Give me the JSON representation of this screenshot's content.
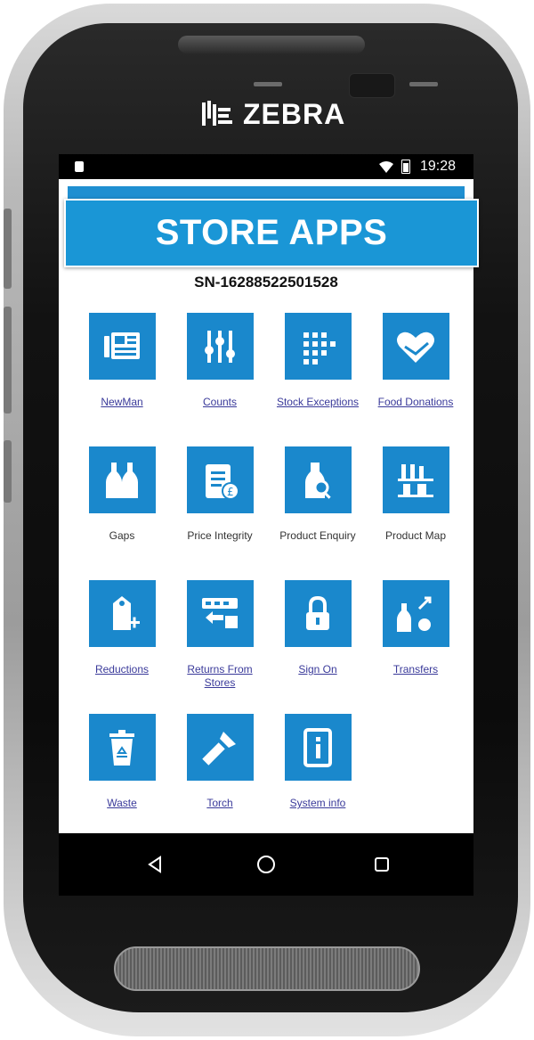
{
  "device": {
    "brand": "ZEBRA"
  },
  "status_bar": {
    "time": "19:28"
  },
  "banner": {
    "title": "STORE APPS"
  },
  "serial": "SN-16288522501528",
  "apps": [
    {
      "label": "NewMan",
      "icon": "newspaper-icon"
    },
    {
      "label": "Counts",
      "icon": "counts-icon"
    },
    {
      "label": "Stock Exceptions",
      "icon": "stock-exceptions-icon"
    },
    {
      "label": "Food Donations",
      "icon": "heart-hands-icon"
    },
    {
      "label": "Gaps",
      "icon": "bottles-icon"
    },
    {
      "label": "Price Integrity",
      "icon": "price-clipboard-icon"
    },
    {
      "label": "Product Enquiry",
      "icon": "bottle-search-icon"
    },
    {
      "label": "Product Map",
      "icon": "shelf-icon"
    },
    {
      "label": "Reductions",
      "icon": "price-tag-icon"
    },
    {
      "label": "Returns From Stores",
      "icon": "store-return-icon"
    },
    {
      "label": "Sign On",
      "icon": "lock-icon"
    },
    {
      "label": "Transfers",
      "icon": "transfer-icon"
    },
    {
      "label": "Waste",
      "icon": "recycle-bin-icon"
    },
    {
      "label": "Torch",
      "icon": "flashlight-icon"
    },
    {
      "label": "System info",
      "icon": "info-icon"
    }
  ],
  "colors": {
    "tile": "#1a88cc",
    "banner": "#1a96d6",
    "link": "#3a3a9a"
  }
}
